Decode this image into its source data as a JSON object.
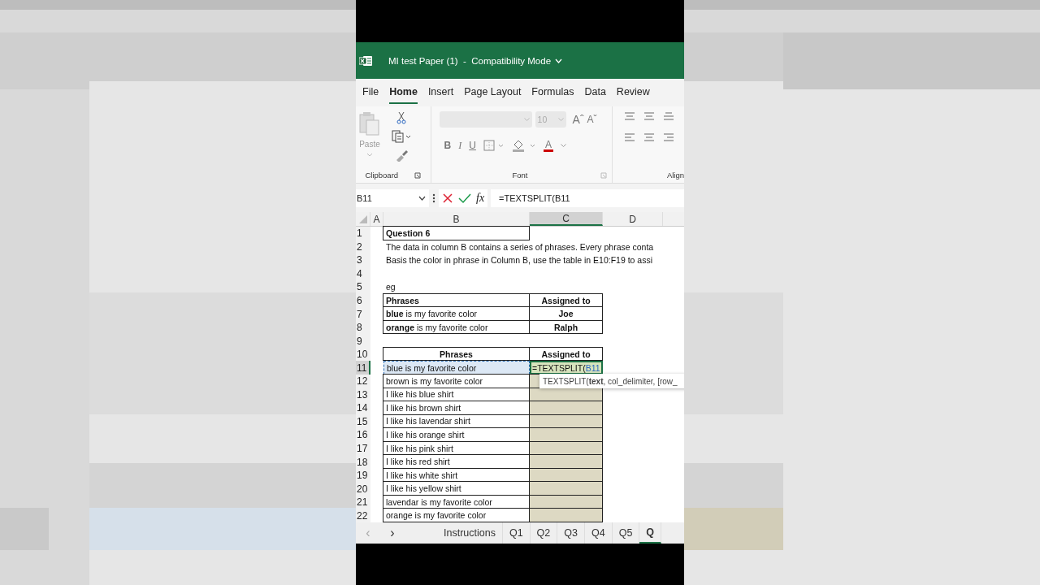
{
  "window": {
    "title": "MI test Paper (1)  -  Compatibility Mode"
  },
  "menu_tabs": [
    {
      "label": "File",
      "selected": false
    },
    {
      "label": "Home",
      "selected": true
    },
    {
      "label": "Insert",
      "selected": false
    },
    {
      "label": "Page Layout",
      "selected": false
    },
    {
      "label": "Formulas",
      "selected": false
    },
    {
      "label": "Data",
      "selected": false
    },
    {
      "label": "Review",
      "selected": false
    }
  ],
  "ribbon": {
    "paste_label": "Paste",
    "font_size": "10",
    "grow_font": "Aˆ",
    "shrink_font": "Aˇ",
    "bold": "B",
    "italic": "I",
    "underline": "U",
    "font_color": "A",
    "groups": [
      "Clipboard",
      "Font",
      "Align"
    ]
  },
  "formula_bar": {
    "name_box": "B11",
    "fx": "fx",
    "formula": "=TEXTSPLIT(B11"
  },
  "columns": [
    {
      "label": "A",
      "selected": false
    },
    {
      "label": "B",
      "selected": false
    },
    {
      "label": "C",
      "selected": true
    },
    {
      "label": "D",
      "selected": false
    }
  ],
  "rows": [
    {
      "number": "1",
      "kind": "title",
      "selected": false,
      "b": "Question 6"
    },
    {
      "number": "2",
      "kind": "text",
      "selected": false,
      "b": "The data in column B contains a series of phrases. Every phrase conta"
    },
    {
      "number": "3",
      "kind": "text",
      "selected": false,
      "b": "Basis the color in phrase in Column B, use the table in E10:F19 to assi"
    },
    {
      "number": "4",
      "kind": "blank",
      "selected": false
    },
    {
      "number": "5",
      "kind": "text",
      "selected": false,
      "b": "eg"
    },
    {
      "number": "6",
      "kind": "example_head",
      "selected": false,
      "b": "Phrases",
      "c": "Assigned to"
    },
    {
      "number": "7",
      "kind": "example_row",
      "selected": false,
      "b": "**blue** is my favorite color",
      "c": "Joe"
    },
    {
      "number": "8",
      "kind": "example_row",
      "selected": false,
      "b": "**orange** is my favorite color",
      "c": "Ralph"
    },
    {
      "number": "9",
      "kind": "blank",
      "selected": false
    },
    {
      "number": "10",
      "kind": "answer_head",
      "selected": false,
      "b": "Phrases",
      "c": "Assigned to"
    },
    {
      "number": "11",
      "kind": "answer_row",
      "selected": true,
      "b": "blue is my favorite color",
      "c": "=TEXTSPLIT(",
      "c_ref": "B11"
    },
    {
      "number": "12",
      "kind": "answer_row",
      "selected": false,
      "b": "brown is my favorite color"
    },
    {
      "number": "13",
      "kind": "answer_row",
      "selected": false,
      "b": "I like his blue shirt"
    },
    {
      "number": "14",
      "kind": "answer_row",
      "selected": false,
      "b": "I like his brown shirt"
    },
    {
      "number": "15",
      "kind": "answer_row",
      "selected": false,
      "b": "I like his lavendar shirt"
    },
    {
      "number": "16",
      "kind": "answer_row",
      "selected": false,
      "b": "I like his orange shirt"
    },
    {
      "number": "17",
      "kind": "answer_row",
      "selected": false,
      "b": "I like his pink shirt"
    },
    {
      "number": "18",
      "kind": "answer_row",
      "selected": false,
      "b": "I like his red shirt"
    },
    {
      "number": "19",
      "kind": "answer_row",
      "selected": false,
      "b": "I like his white shirt"
    },
    {
      "number": "20",
      "kind": "answer_row",
      "selected": false,
      "b": "I like his yellow shirt"
    },
    {
      "number": "21",
      "kind": "answer_row",
      "selected": false,
      "b": "lavendar is my favorite color"
    },
    {
      "number": "22",
      "kind": "answer_row",
      "selected": false,
      "b": "orange is my favorite color"
    }
  ],
  "tooltip": "TEXTSPLIT(**text**, col_delimiter, [row_",
  "sheet_tabs": {
    "prev": "‹",
    "next": "›",
    "tabs": [
      {
        "label": "Instructions",
        "selected": false
      },
      {
        "label": "Q1",
        "selected": false
      },
      {
        "label": "Q2",
        "selected": false
      },
      {
        "label": "Q3",
        "selected": false
      },
      {
        "label": "Q4",
        "selected": false
      },
      {
        "label": "Q5",
        "selected": false
      },
      {
        "label": "Q",
        "selected": true
      }
    ]
  }
}
